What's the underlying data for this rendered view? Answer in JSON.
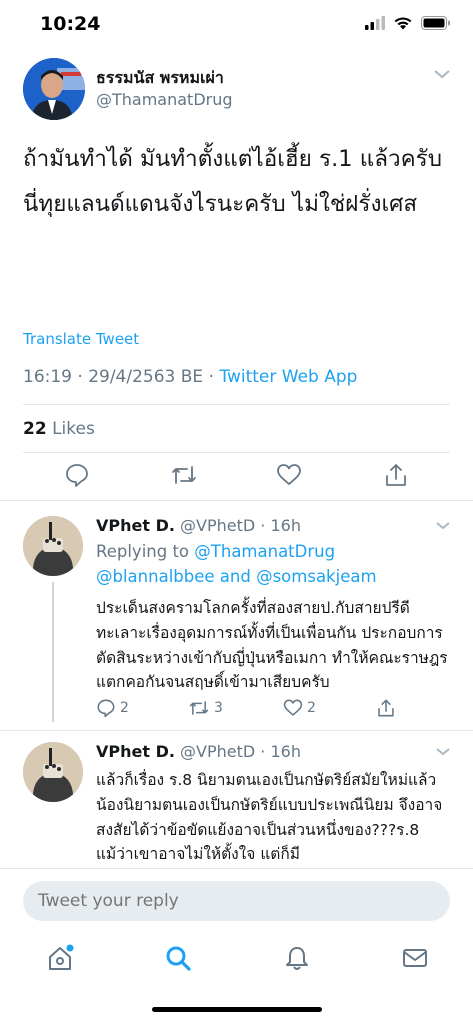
{
  "status": {
    "time": "10:24"
  },
  "tweet": {
    "author_name": "ธรรมนัส พรหมเผ่า",
    "author_handle": "@ThamanatDrug",
    "text_lines": [
      "ถ้ามันทำได้ มันทำตั้งแต่ไอ้เฮี้ย ร.1 แล้วครับ",
      "นี่ทุยแลนด์แดนจังไรนะครับ ไม่ใช่ฝรั่งเศส"
    ],
    "translate_label": "Translate Tweet",
    "timestamp": "16:19 · 29/4/2563 BE · ",
    "app": "Twitter Web App",
    "likes_count": "22",
    "likes_label": "Likes"
  },
  "replies": [
    {
      "name": "VPhet D.",
      "handle": "@VPhetD · 16h",
      "replying_prefix": "Replying to ",
      "replying_to_1": "@ThamanatDrug",
      "replying_to_2": "@blannalbbee",
      "replying_and": " and ",
      "replying_to_3": "@somsakjeam",
      "text": "ประเด็นสงครามโลกครั้งที่สองสายป.กับสายปรีดีทะเลาะเรื่องอุดมการณ์ทั้งที่เป็นเพื่อนกัน ประกอบการตัดสินระหว่างเข้ากับญี่ปุ่นหรือเมกา ทำให้คณะราษฎรแตกคอกันจนสฤษดิ์เข้ามาเสียบครับ",
      "reply_count": "2",
      "retweet_count": "3",
      "like_count": "2"
    },
    {
      "name": "VPhet D.",
      "handle": "@VPhetD · 16h",
      "text": "แล้วก็เรื่อง ร.8 นิยามตนเองเป็นกษัตริย์สมัยใหม่แล้ว น้องนิยามตนเองเป็นกษัตริย์แบบประเพณีนิยม จึงอาจสงสัยได้ว่าข้อขัดแย้งอาจเป็นส่วนหนึ่งของ???ร.8 แม้ว่าเขาอาจไม่ให้ตั้งใจ แต่ก็มี"
    }
  ],
  "reply_box": {
    "placeholder": "Tweet your reply"
  },
  "colors": {
    "accent": "#1da1f2",
    "secondary_text": "#657786"
  }
}
